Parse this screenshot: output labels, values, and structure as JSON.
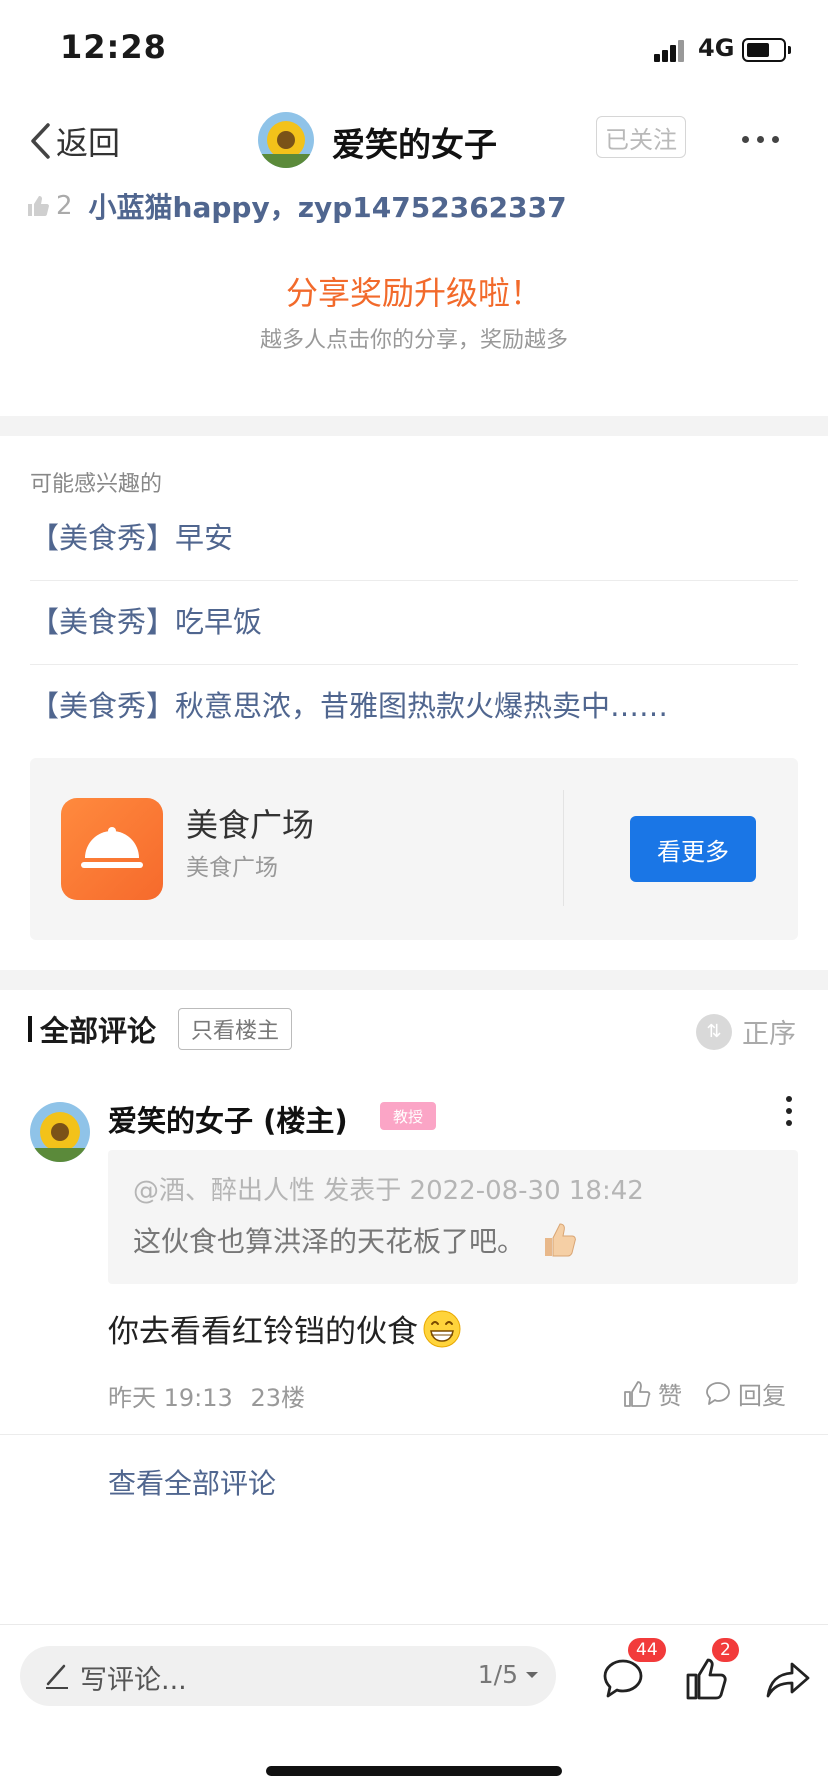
{
  "status": {
    "time": "12:28",
    "network": "4G"
  },
  "nav": {
    "back_label": "返回",
    "title": "爱笑的女子",
    "follow_label": "已关注"
  },
  "likes": {
    "count": "2",
    "users": "小蓝猫happy，zyp14752362337"
  },
  "reward": {
    "title": "分享奖励升级啦！",
    "subtitle": "越多人点击你的分享，奖励越多"
  },
  "recommend": {
    "heading": "可能感兴趣的",
    "items": [
      "【美食秀】早安",
      "【美食秀】吃早饭",
      "【美食秀】秋意思浓，昔雅图热款火爆热卖中……"
    ]
  },
  "plaza": {
    "title": "美食广场",
    "subtitle": "美食广场",
    "button": "看更多"
  },
  "comments": {
    "title": "全部评论",
    "only_owner": "只看楼主",
    "order": "正序",
    "item": {
      "author": "爱笑的女子 (楼主)",
      "badge": "教授",
      "quote_meta": "@酒、醉出人性 发表于 2022-08-30 18:42",
      "quote_text": "这伙食也算洪泽的天花板了吧。",
      "body": "你去看看红铃铛的伙食",
      "time": "昨天 19:13",
      "floor": "23楼",
      "like_label": "赞",
      "reply_label": "回复"
    },
    "see_all": "查看全部评论"
  },
  "bottom": {
    "input_placeholder": "写评论...",
    "page": "1/5",
    "comment_badge": "44",
    "like_badge": "2"
  },
  "colors": {
    "accent_orange": "#f26a2b",
    "link_blue": "#50668f",
    "button_blue": "#1a76e6",
    "badge_red": "#f23b3b"
  },
  "icons": [
    "back-chevron-icon",
    "more-icon",
    "thumb-up-icon",
    "plaza-dish-icon",
    "order-icon",
    "pen-icon",
    "comment-icon",
    "share-icon",
    "emoji-grin-icon",
    "thumb-emoji-icon"
  ]
}
